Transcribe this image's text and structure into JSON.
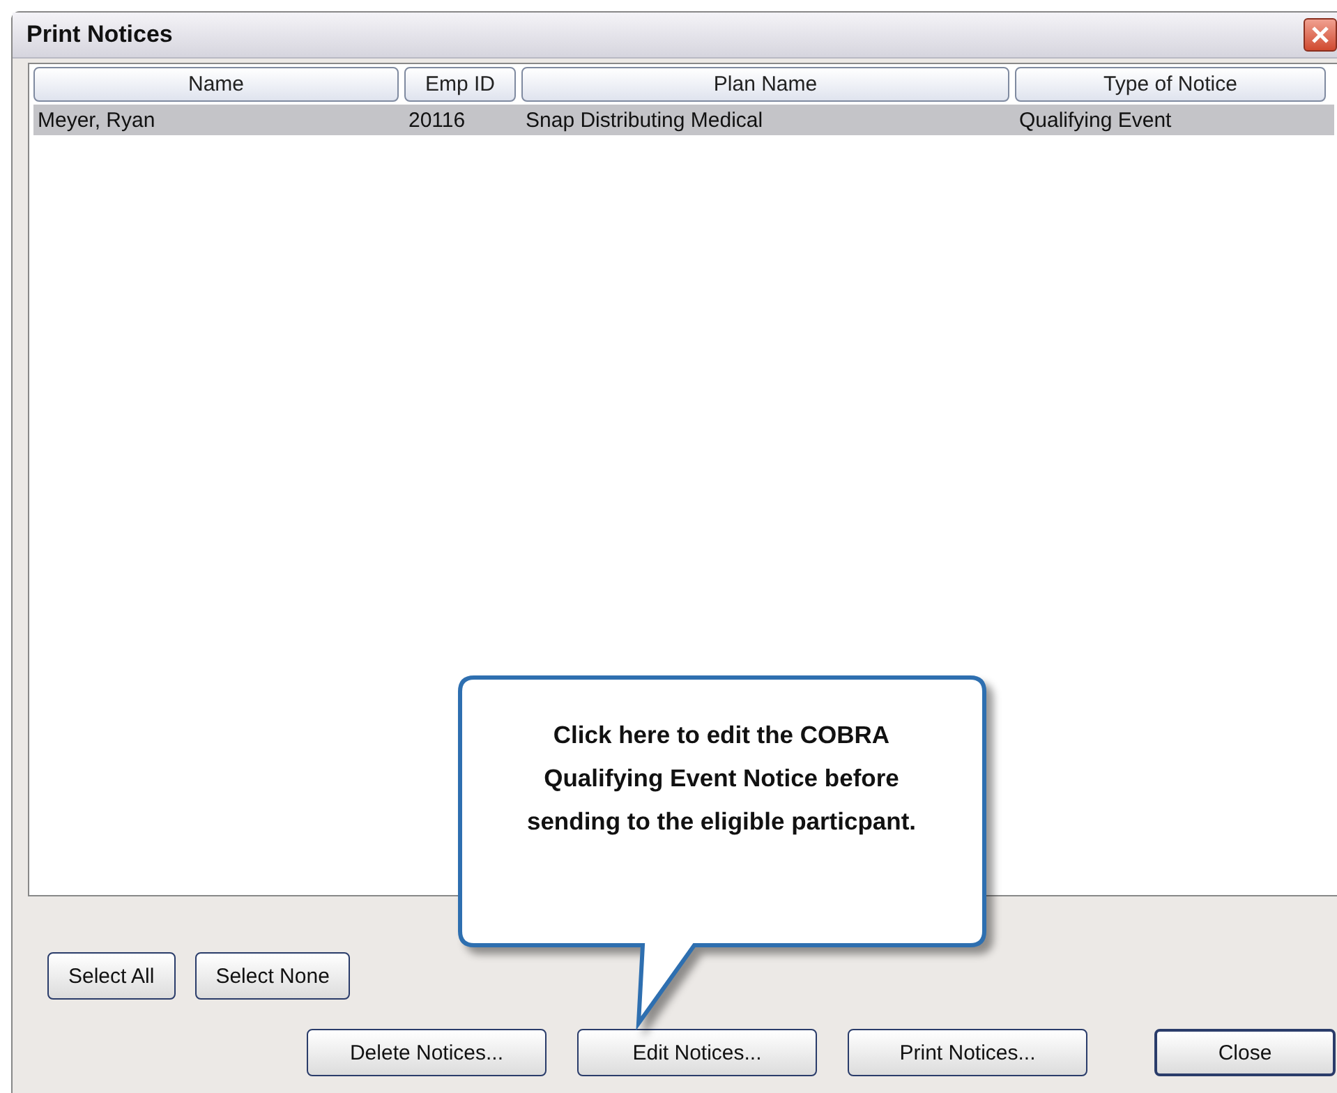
{
  "window": {
    "title": "Print Notices"
  },
  "table": {
    "columns": [
      "Name",
      "Emp ID",
      "Plan Name",
      "Type of Notice"
    ],
    "rows": [
      {
        "cells": [
          "Meyer, Ryan",
          "20116",
          "Snap Distributing Medical",
          "Qualifying Event"
        ],
        "selected": true
      }
    ]
  },
  "selection_buttons": [
    "Select All",
    "Select None"
  ],
  "action_buttons": [
    {
      "label": "Delete Notices...",
      "kind": "normal"
    },
    {
      "label": "Edit Notices...",
      "kind": "normal"
    },
    {
      "label": "Print Notices...",
      "kind": "normal"
    },
    {
      "label": "Close",
      "kind": "default"
    }
  ],
  "callout": {
    "text": "Click here to edit the COBRA Qualifying Event Notice before sending to the eligible particpant."
  }
}
